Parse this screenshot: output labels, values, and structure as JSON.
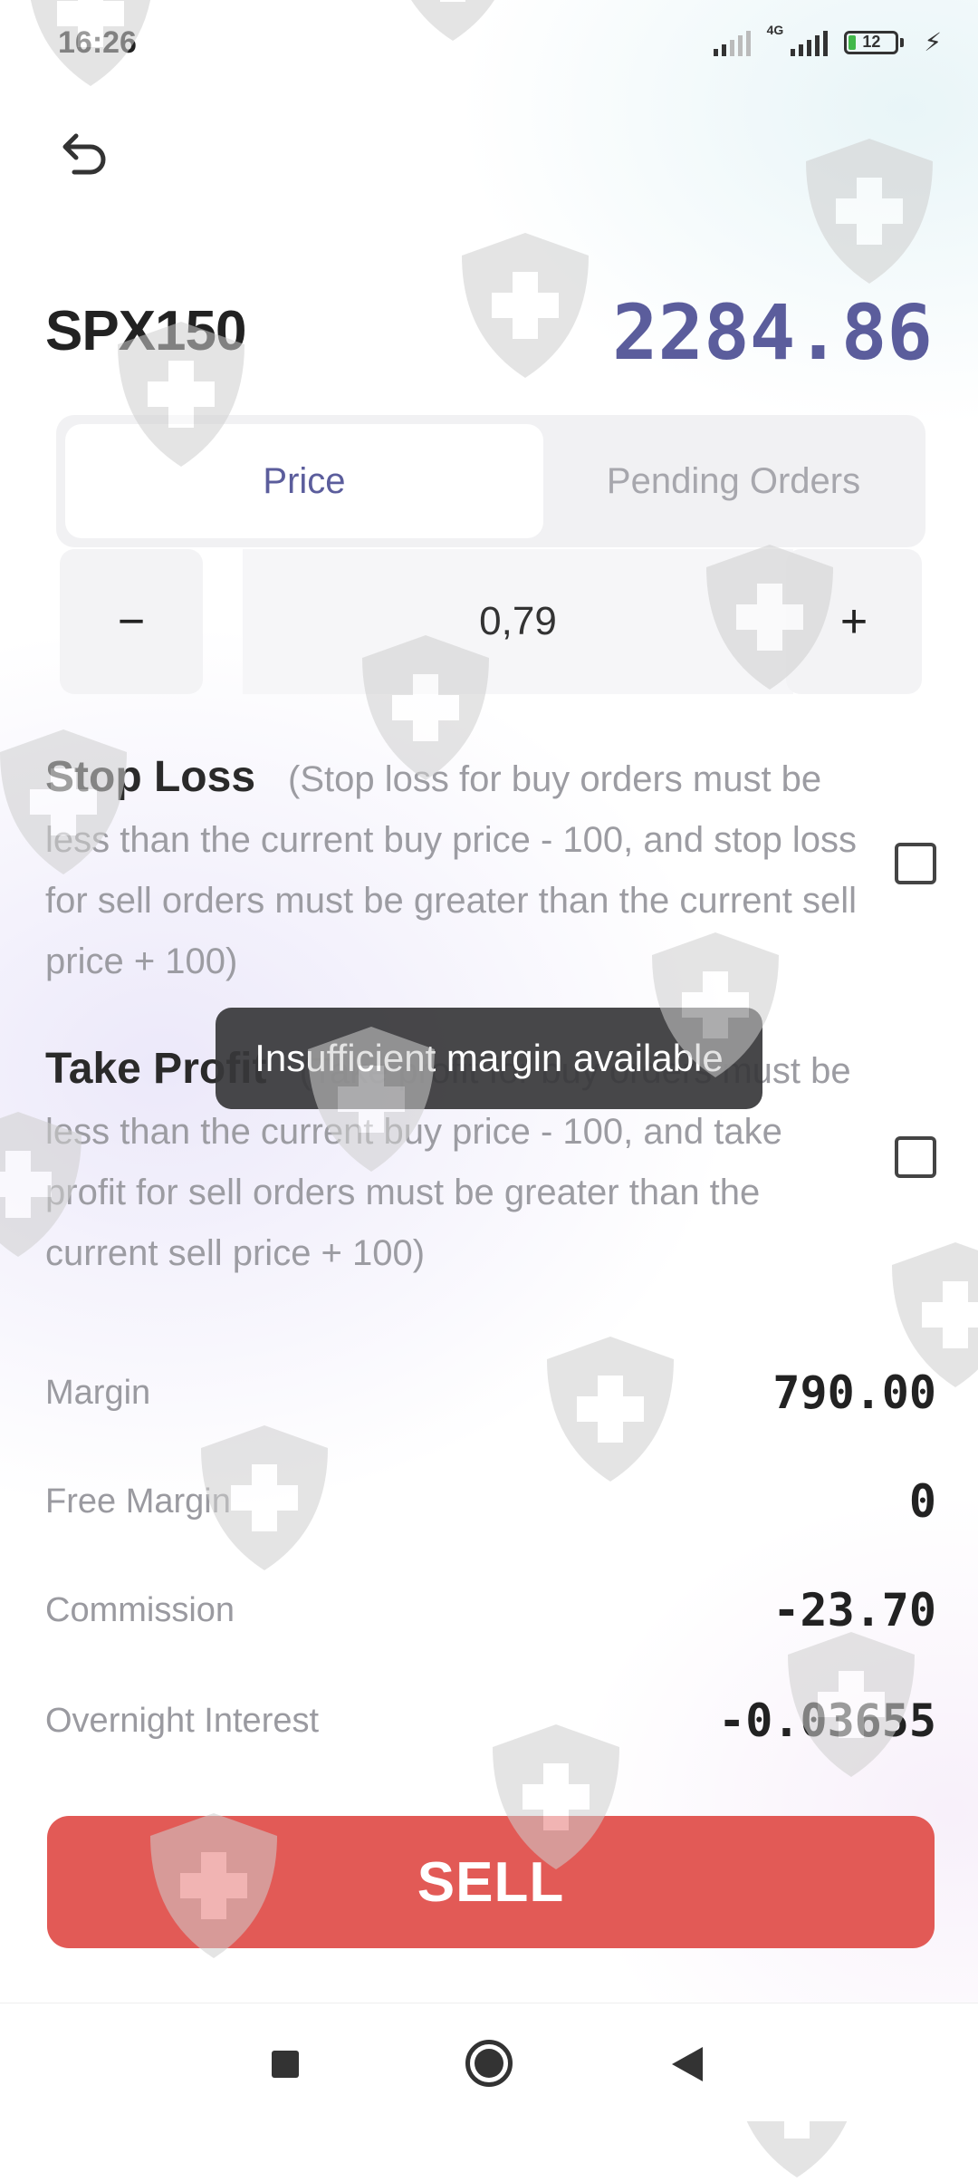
{
  "status_bar": {
    "time": "16:26",
    "network": "4G",
    "battery": "12"
  },
  "header": {
    "symbol": "SPX150",
    "price": "2284.86"
  },
  "tabs": [
    {
      "label": "Price",
      "active": true
    },
    {
      "label": "Pending Orders",
      "active": false
    }
  ],
  "stepper": {
    "minus": "−",
    "value": "0,79",
    "plus": "+"
  },
  "stop_loss": {
    "title": "Stop Loss",
    "description": "(Stop loss for buy orders must be less than the current buy price - 100, and stop loss for sell orders must be greater than the current sell price + 100)",
    "checked": false
  },
  "take_profit": {
    "title": "Take Profit",
    "description": "(Take profit for buy orders must be less than the current buy price - 100, and take profit for sell orders must be greater than the current sell price + 100)",
    "checked": false
  },
  "toast": "Insufficient margin available",
  "info": [
    {
      "label": "Margin",
      "value": "790.00"
    },
    {
      "label": "Free Margin",
      "value": "0"
    },
    {
      "label": "Commission",
      "value": "-23.70"
    },
    {
      "label": "Overnight Interest",
      "value": "-0.03655"
    }
  ],
  "sell_button": "SELL",
  "colors": {
    "accent": "#5b5d9c",
    "sell": "#e25a56",
    "muted_text": "#9c9ca2",
    "toast_bg": "#37373a"
  },
  "icons": {
    "back": "undo-arrow-icon",
    "nav_recent": "square-icon",
    "nav_home": "circle-icon",
    "nav_back": "triangle-back-icon",
    "watermark": "shield-cross-icon"
  }
}
